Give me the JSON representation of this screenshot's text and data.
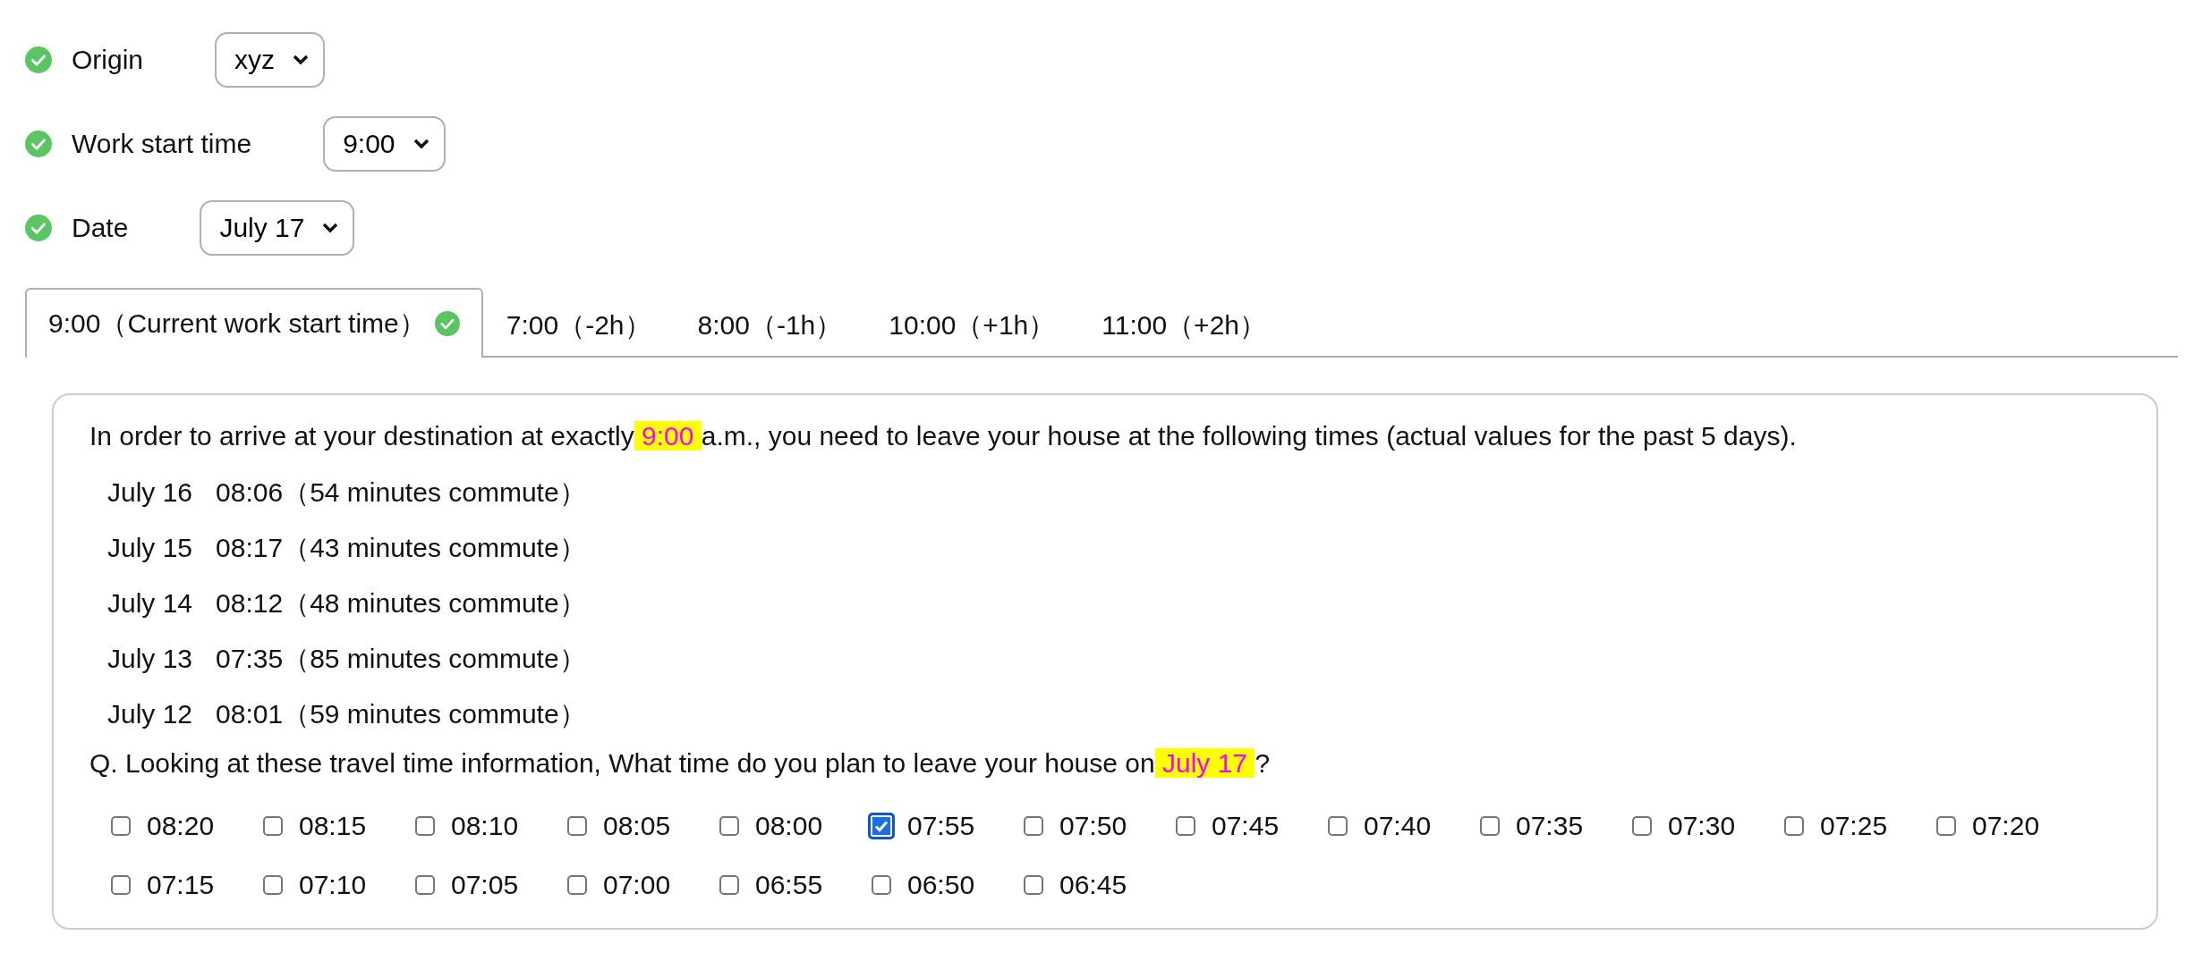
{
  "settings": [
    {
      "label": "Origin",
      "value": "xyz",
      "done": true
    },
    {
      "label": "Work start time",
      "value": "9:00",
      "done": true
    },
    {
      "label": "Date",
      "value": "July 17",
      "done": true
    }
  ],
  "tabs": [
    {
      "label": "9:00（Current work start time）",
      "selected": true,
      "done": true
    },
    {
      "label": "7:00（-2h）",
      "selected": false,
      "done": false
    },
    {
      "label": "8:00（-1h）",
      "selected": false,
      "done": false
    },
    {
      "label": "10:00（+1h）",
      "selected": false,
      "done": false
    },
    {
      "label": "11:00（+2h）",
      "selected": false,
      "done": false
    }
  ],
  "panel": {
    "intro": {
      "before": "In order to arrive at your destination at exactly",
      "highlight": " 9:00 ",
      "after": "a.m., you need to leave your house at the following times (actual values for the past 5 days)."
    },
    "records": [
      {
        "date": "July 16",
        "detail": "08:06（54 minutes commute）"
      },
      {
        "date": "July 15",
        "detail": "08:17（43 minutes commute）"
      },
      {
        "date": "July 14",
        "detail": "08:12（48 minutes commute）"
      },
      {
        "date": "July 13",
        "detail": "07:35（85 minutes commute）"
      },
      {
        "date": "July 12",
        "detail": "08:01（59 minutes commute）"
      }
    ],
    "question": {
      "before": "Q. Looking at these travel time information, What time do you plan to leave your house on",
      "highlight": " July 17 ",
      "after": "?"
    },
    "options": [
      {
        "label": "08:20",
        "checked": false
      },
      {
        "label": "08:15",
        "checked": false
      },
      {
        "label": "08:10",
        "checked": false
      },
      {
        "label": "08:05",
        "checked": false
      },
      {
        "label": "08:00",
        "checked": false
      },
      {
        "label": "07:55",
        "checked": true
      },
      {
        "label": "07:50",
        "checked": false
      },
      {
        "label": "07:45",
        "checked": false
      },
      {
        "label": "07:40",
        "checked": false
      },
      {
        "label": "07:35",
        "checked": false
      },
      {
        "label": "07:30",
        "checked": false
      },
      {
        "label": "07:25",
        "checked": false
      },
      {
        "label": "07:20",
        "checked": false
      },
      {
        "label": "07:15",
        "checked": false
      },
      {
        "label": "07:10",
        "checked": false
      },
      {
        "label": "07:05",
        "checked": false
      },
      {
        "label": "07:00",
        "checked": false
      },
      {
        "label": "06:55",
        "checked": false
      },
      {
        "label": "06:50",
        "checked": false
      },
      {
        "label": "06:45",
        "checked": false
      }
    ]
  }
}
